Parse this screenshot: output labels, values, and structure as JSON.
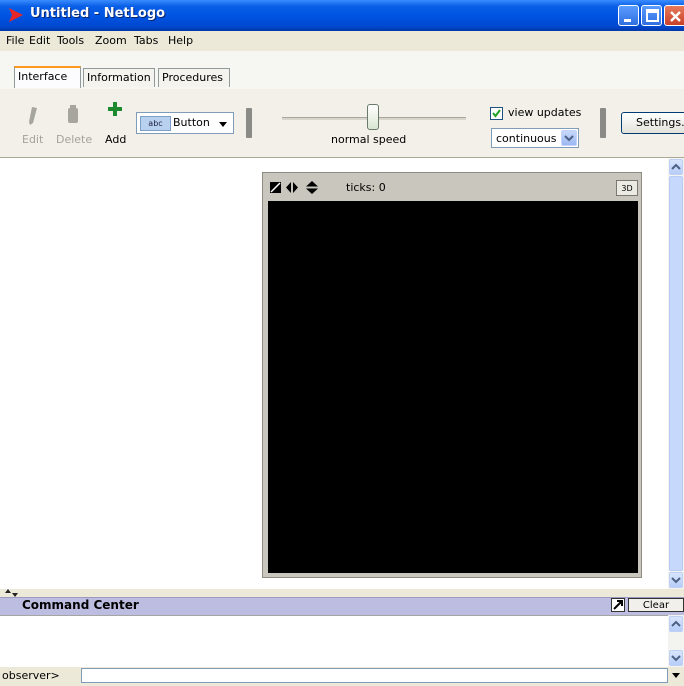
{
  "window": {
    "title": "Untitled - NetLogo"
  },
  "menu": [
    "File",
    "Edit",
    "Tools",
    "Zoom",
    "Tabs",
    "Help"
  ],
  "tabs": [
    {
      "label": "Interface",
      "active": true
    },
    {
      "label": "Information",
      "active": false
    },
    {
      "label": "Procedures",
      "active": false
    }
  ],
  "toolbar": {
    "edit_label": "Edit",
    "delete_label": "Delete",
    "add_label": "Add",
    "widget_type": "Button",
    "widget_type_icon_text": "abc",
    "speed_label": "normal speed",
    "speed_value": 0.5,
    "view_updates_label": "view updates",
    "view_updates_checked": true,
    "update_mode": "continuous",
    "settings_label": "Settings..."
  },
  "view": {
    "ticks_label": "ticks: 0",
    "btn_3d_label": "3D"
  },
  "command_center": {
    "title": "Command Center",
    "clear_label": "Clear",
    "prompt": "observer>",
    "input_value": ""
  },
  "colors": {
    "titlebar": "#0054e3",
    "world_bg": "#000000",
    "command_header": "#bcbde0",
    "add_icon": "#1e8a2e"
  }
}
